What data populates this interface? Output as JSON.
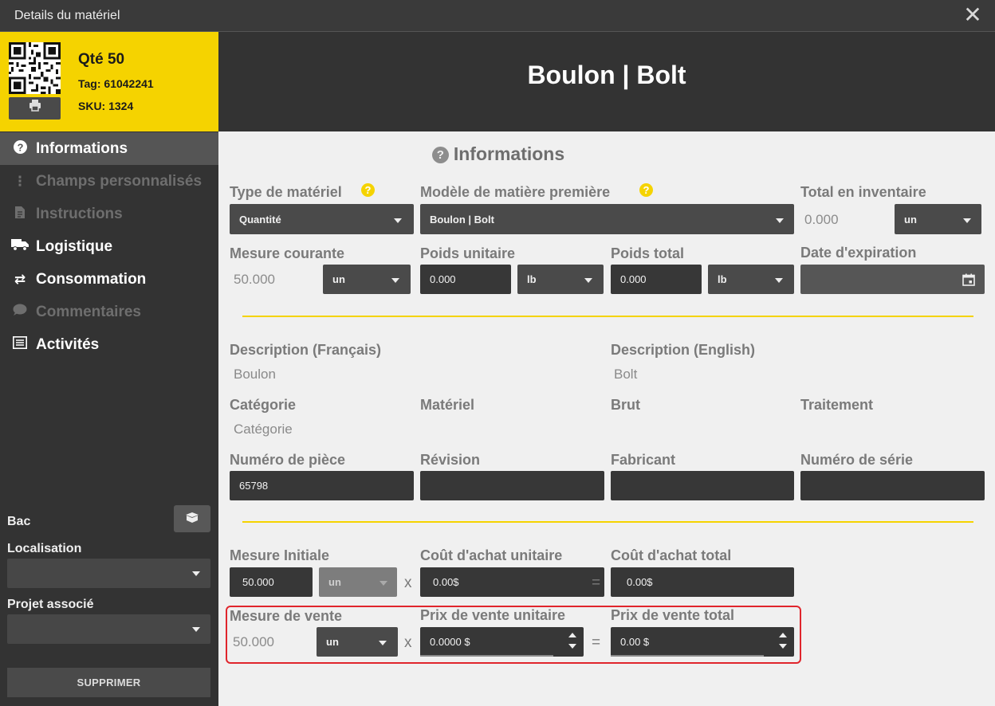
{
  "window": {
    "title": "Details du matériel",
    "close_icon": "close-icon"
  },
  "card": {
    "qty": "Qté 50",
    "tag": "Tag: 61042241",
    "sku": "SKU: 1324",
    "print_icon": "printer-icon"
  },
  "nav": [
    {
      "label": "Informations",
      "icon": "help-circle-icon",
      "state": "active"
    },
    {
      "label": "Champs personnalisés",
      "icon": "vertical-dots-icon",
      "state": "disabled"
    },
    {
      "label": "Instructions",
      "icon": "document-icon",
      "state": "disabled"
    },
    {
      "label": "Logistique",
      "icon": "truck-icon",
      "state": "enabled"
    },
    {
      "label": "Consommation",
      "icon": "swap-arrows-icon",
      "state": "enabled"
    },
    {
      "label": "Commentaires",
      "icon": "comment-icon",
      "state": "disabled"
    },
    {
      "label": "Activités",
      "icon": "list-icon",
      "state": "enabled"
    }
  ],
  "sidebar": {
    "bac_label": "Bac",
    "localisation_label": "Localisation",
    "localisation_value": "",
    "projet_label": "Projet associé",
    "projet_value": "",
    "delete_label": "SUPPRIMER"
  },
  "header": {
    "title": "Boulon | Bolt"
  },
  "section": {
    "title": "Informations"
  },
  "fields": {
    "type_label": "Type de matériel",
    "type_value": "Quantité",
    "model_label": "Modèle de matière première",
    "model_value": "Boulon | Bolt",
    "stock_label": "Total en inventaire",
    "stock_value": "0.000",
    "stock_unit": "un",
    "mesure_label": "Mesure courante",
    "mesure_value": "50.000",
    "mesure_unit": "un",
    "poids_u_label": "Poids unitaire",
    "poids_u_value": "0.000",
    "poids_u_unit": "lb",
    "poids_t_label": "Poids total",
    "poids_t_value": "0.000",
    "poids_t_unit": "lb",
    "expiration_label": "Date d'expiration",
    "expiration_value": "",
    "desc_fr_label": "Description (Français)",
    "desc_fr_value": "Boulon",
    "desc_en_label": "Description (English)",
    "desc_en_value": "Bolt",
    "categorie_label": "Catégorie",
    "categorie_value": "Catégorie",
    "materiel_label": "Matériel",
    "brut_label": "Brut",
    "traitement_label": "Traitement",
    "piece_label": "Numéro de pièce",
    "piece_value": "65798",
    "revision_label": "Révision",
    "revision_value": "",
    "fabricant_label": "Fabricant",
    "fabricant_value": "",
    "serie_label": "Numéro de série",
    "serie_value": "",
    "mesure_init_label": "Mesure Initiale",
    "mesure_init_value": "50.000",
    "mesure_init_unit": "un",
    "cout_u_label": "Coût d'achat unitaire",
    "cout_u_value": "0.00$",
    "cout_t_label": "Coût d'achat total",
    "cout_t_value": "0.00$",
    "mesure_vente_label": "Mesure de vente",
    "mesure_vente_value": "50.000",
    "mesure_vente_unit": "un",
    "prix_u_label": "Prix de vente unitaire",
    "prix_u_value": "0.0000 $",
    "prix_t_label": "Prix de vente total",
    "prix_t_value": "0.00 $",
    "multiply_symbol": "x",
    "equals_symbol": "="
  },
  "colors": {
    "accent": "#f5d300",
    "highlight_border": "#e0252c",
    "panel": "#333333",
    "content_bg": "#f0f0f0"
  }
}
